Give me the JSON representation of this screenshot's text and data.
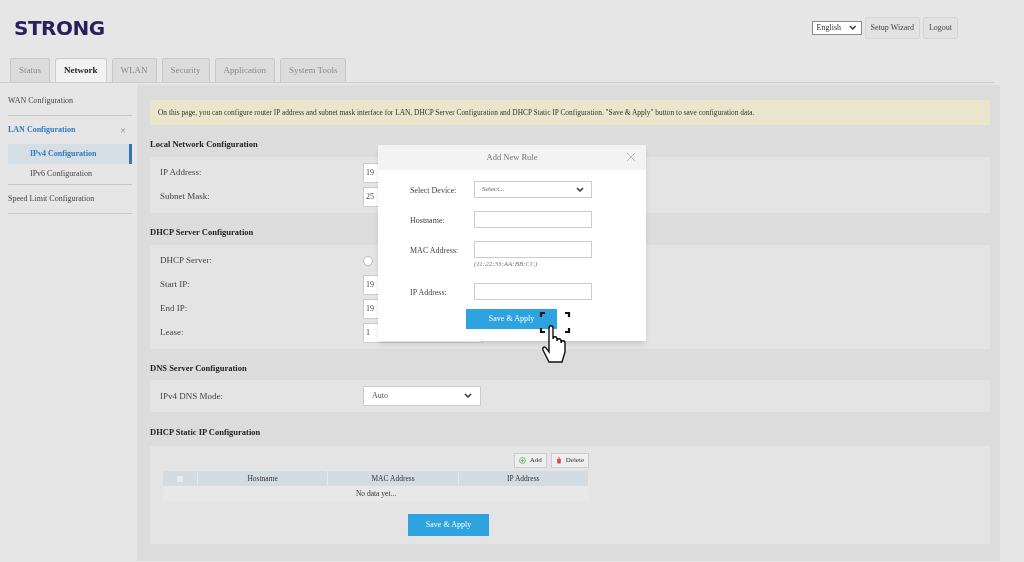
{
  "logo": "STRONG",
  "header": {
    "language": "English",
    "buttons": [
      "Setup Wizard",
      "Logout"
    ]
  },
  "tabs": [
    {
      "label": "Status",
      "selected": false
    },
    {
      "label": "Network",
      "selected": true
    },
    {
      "label": "WLAN",
      "selected": false
    },
    {
      "label": "Security",
      "selected": false
    },
    {
      "label": "Application",
      "selected": false
    },
    {
      "label": "System Tools",
      "selected": false
    }
  ],
  "sidebar": {
    "items": [
      {
        "label": "WAN Configuration",
        "selected": false
      },
      {
        "label": "LAN Configuration",
        "selected": true,
        "expanded": true,
        "toggle": "×",
        "children": [
          {
            "label": "IPv4 Configuration",
            "selected": true
          },
          {
            "label": "IPv6 Configuration",
            "selected": false
          }
        ]
      },
      {
        "label": "Speed Limit Configuration",
        "selected": false
      }
    ]
  },
  "notice": "On this page, you can configure router IP address and subnet mask interface for LAN, DHCP Server Configuration and DHCP Static IP Configuration. \"Save & Apply\" button to save configuration data.",
  "sections": [
    {
      "title": "Local Network Configuration",
      "rows": [
        {
          "kind": "input",
          "label": "IP Address:",
          "value": "19"
        },
        {
          "kind": "input",
          "label": "Subnet Mask:",
          "value": "25"
        }
      ]
    },
    {
      "title": "DHCP Server Configuration",
      "rows": [
        {
          "kind": "radio",
          "label": "DHCP Server:",
          "checked": false
        },
        {
          "kind": "input",
          "label": "Start IP:",
          "value": "19"
        },
        {
          "kind": "input",
          "label": "End IP:",
          "value": "19"
        },
        {
          "kind": "input",
          "label": "Lease:",
          "value": "1"
        }
      ]
    },
    {
      "title": "DNS Server Configuration",
      "rows": [
        {
          "kind": "select",
          "label": "IPv4 DNS Mode:",
          "value": "Auto"
        }
      ]
    }
  ],
  "static": {
    "title": "DHCP Static IP Configuration",
    "add": "Add",
    "delete": "Delete",
    "select_all": {
      "checked": false
    },
    "columns": [
      "Hostname",
      "MAC Address",
      "IP Address"
    ],
    "empty": "No data yet...",
    "save": "Save & Apply"
  },
  "dialog": {
    "title": "Add New Rule",
    "fields": [
      {
        "kind": "select",
        "label": "Select Device:",
        "value": "Select..."
      },
      {
        "kind": "input",
        "label": "Hostname:"
      },
      {
        "kind": "input",
        "label": "MAC Address:",
        "hint": "(11:22:33:AA:BB:CC)"
      },
      {
        "kind": "input",
        "label": "IP Address:"
      }
    ],
    "save": "Save & Apply"
  }
}
